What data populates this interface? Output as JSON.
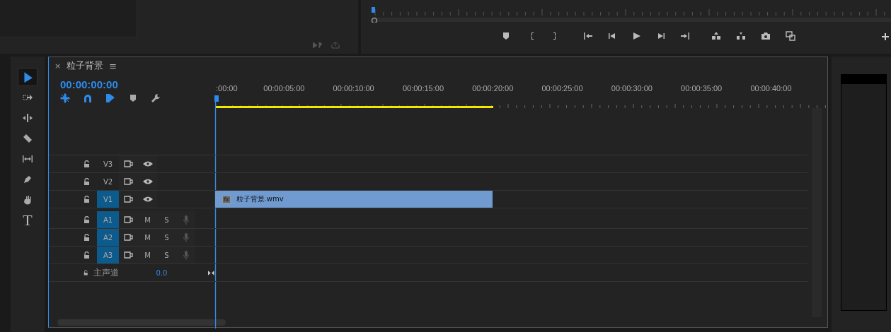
{
  "tools": [
    {
      "kind": "selection",
      "selected": true
    },
    {
      "kind": "track-select",
      "selected": false
    },
    {
      "kind": "ripple",
      "selected": false
    },
    {
      "kind": "razor",
      "selected": false
    },
    {
      "kind": "slip",
      "selected": false
    },
    {
      "kind": "pen",
      "selected": false
    },
    {
      "kind": "hand",
      "selected": false
    },
    {
      "kind": "type",
      "selected": false,
      "glyph": "T"
    }
  ],
  "timeline": {
    "close": "×",
    "title": "粒子背景",
    "menu": "≡",
    "timecode": "00:00:00:00",
    "toolbar": [
      {
        "kind": "nest",
        "on": true
      },
      {
        "kind": "snap",
        "on": true
      },
      {
        "kind": "linked",
        "on": true
      },
      {
        "kind": "marker",
        "on": false
      },
      {
        "kind": "settings",
        "on": false
      }
    ],
    "ruler_labels": [
      ":00:00",
      "00:00:05:00",
      "00:00:10:00",
      "00:00:15:00",
      "00:00:20:00",
      "00:00:25:00",
      "00:00:30:00",
      "00:00:35:00",
      "00:00:40:00"
    ],
    "tracks": [
      {
        "kind": "video",
        "name": "V3",
        "targeted": false
      },
      {
        "kind": "video",
        "name": "V2",
        "targeted": false
      },
      {
        "kind": "video",
        "name": "V1",
        "targeted": true,
        "clip": {
          "badge": "fx",
          "name": "粒子背景.wmv"
        }
      },
      {
        "kind": "audio",
        "name": "A1",
        "targeted": true,
        "mute": "M",
        "solo": "S"
      },
      {
        "kind": "audio",
        "name": "A2",
        "targeted": true,
        "mute": "M",
        "solo": "S"
      },
      {
        "kind": "audio",
        "name": "A3",
        "targeted": true,
        "mute": "M",
        "solo": "S"
      },
      {
        "kind": "master",
        "name": "主声道",
        "value": "0.0"
      }
    ]
  }
}
